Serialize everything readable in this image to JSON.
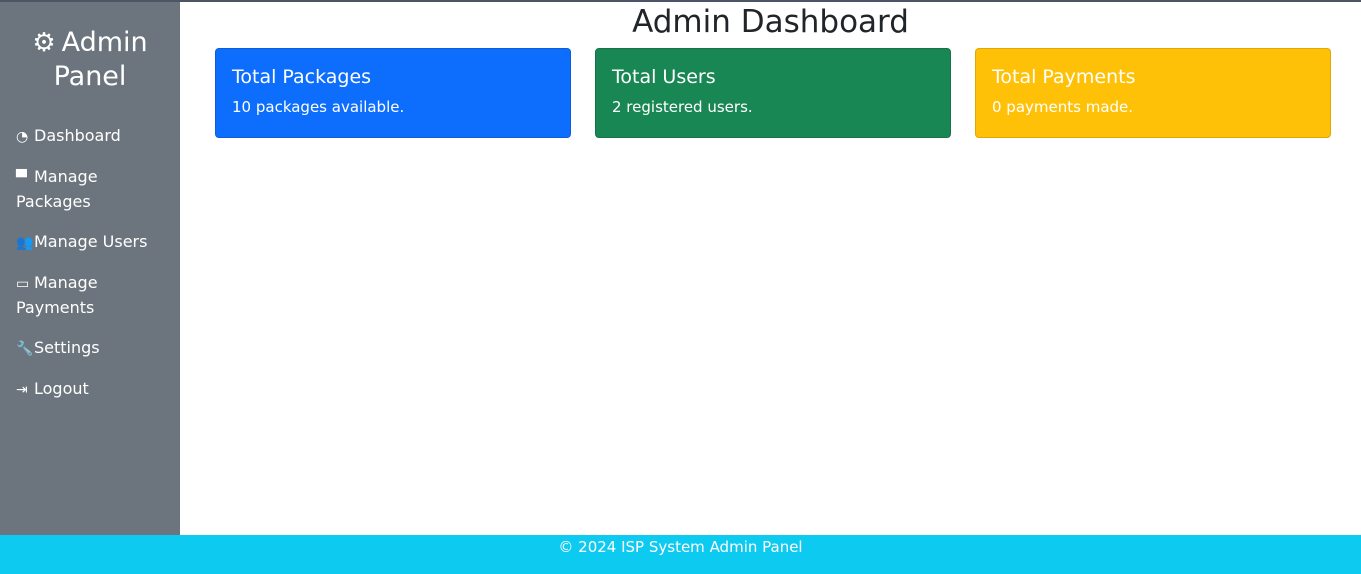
{
  "sidebar": {
    "brand_icon": "cogs-icon",
    "brand_line1": "Admin",
    "brand_line2": "Panel",
    "items": [
      {
        "label": "Dashboard",
        "icon": "tachometer-icon"
      },
      {
        "label": "Manage Packages",
        "icon": "archive-icon"
      },
      {
        "label": "Manage Users",
        "icon": "users-icon"
      },
      {
        "label": "Manage Payments",
        "icon": "credit-card-icon"
      },
      {
        "label": "Settings",
        "icon": "wrench-icon"
      },
      {
        "label": "Logout",
        "icon": "sign-out-icon"
      }
    ]
  },
  "main": {
    "title": "Admin Dashboard",
    "cards": [
      {
        "title": "Total Packages",
        "text": "10 packages available.",
        "color": "#0d6efd"
      },
      {
        "title": "Total Users",
        "text": "2 registered users.",
        "color": "#198754"
      },
      {
        "title": "Total Payments",
        "text": "0 payments made.",
        "color": "#ffc107"
      }
    ]
  },
  "footer": {
    "text": "© 2024 ISP System Admin Panel",
    "color": "#0dcaf0"
  }
}
